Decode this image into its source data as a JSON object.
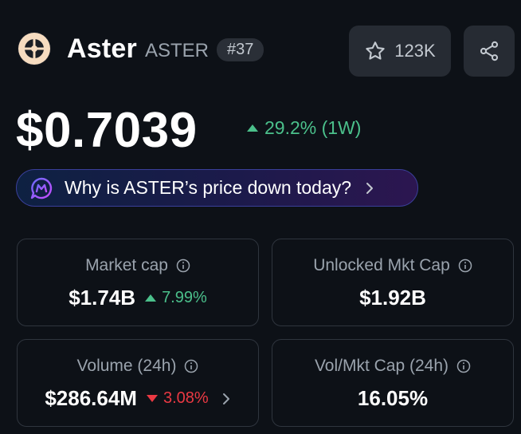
{
  "coin": {
    "name": "Aster",
    "symbol": "ASTER",
    "rank": "#37",
    "watchlist_count": "123K"
  },
  "price": {
    "value": "$0.7039",
    "change": "29.2% (1W)",
    "change_direction": "up"
  },
  "ai_prompt": {
    "text": "Why is ASTER’s price down today?"
  },
  "stats": {
    "market_cap": {
      "label": "Market cap",
      "value": "$1.74B",
      "change": "7.99%",
      "direction": "up"
    },
    "unlocked_mkt_cap": {
      "label": "Unlocked Mkt Cap",
      "value": "$1.92B"
    },
    "volume_24h": {
      "label": "Volume (24h)",
      "value": "$286.64M",
      "change": "3.08%",
      "direction": "down"
    },
    "vol_mkt_cap_24h": {
      "label": "Vol/Mkt Cap (24h)",
      "value": "16.05%"
    }
  },
  "colors": {
    "background": "#0d1117",
    "positive": "#4bc08b",
    "negative": "#ea3943",
    "muted": "#9aa3ad"
  }
}
